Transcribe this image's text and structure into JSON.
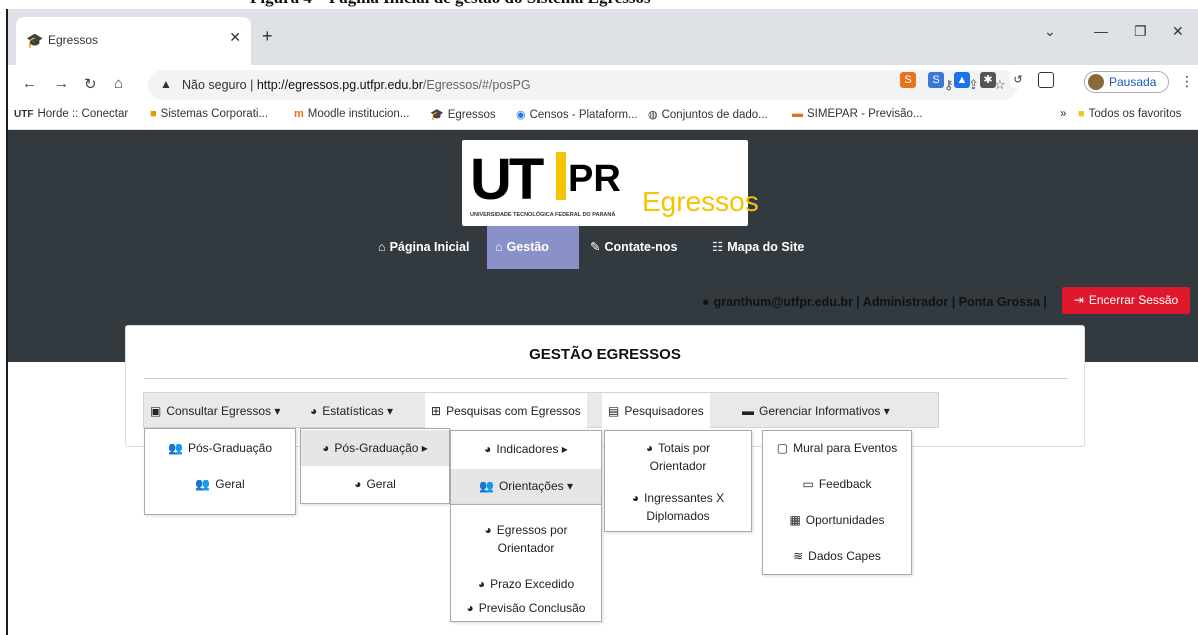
{
  "caption": "Figura 4 – Pagina Inicial de gestão do Sistema Egressos",
  "browser": {
    "tab_title": "Egressos",
    "address_warning": "Não seguro",
    "url_host": "http://egressos.pg.utfpr.edu.br",
    "url_path": "/Egressos/#/posPG",
    "profile_label": "Pausada"
  },
  "bookmarks": [
    {
      "label": "Horde :: Conectar",
      "icon": "utf-icon"
    },
    {
      "label": "Sistemas Corporati...",
      "icon": "sistemas-icon"
    },
    {
      "label": "Moodle institucion...",
      "icon": "moodle-icon"
    },
    {
      "label": "Egressos",
      "icon": "graduation-cap-icon"
    },
    {
      "label": "Censos - Plataform...",
      "icon": "censos-icon"
    },
    {
      "label": "Conjuntos de dado...",
      "icon": "globe-icon"
    },
    {
      "label": "SIMEPAR - Previsão...",
      "icon": "simepar-icon"
    },
    {
      "label": "Todos os favoritos",
      "icon": "folder-icon"
    }
  ],
  "logo": {
    "mark": "UT",
    "mark2": "PR",
    "sub": "UNIVERSIDADE TECNOLÓGICA FEDERAL DO PARANÁ",
    "product": "Egressos"
  },
  "nav": [
    {
      "label": "Página Inicial",
      "icon": "home-icon",
      "active": false
    },
    {
      "label": "Gestão",
      "icon": "institution-icon",
      "active": true
    },
    {
      "label": "Contate-nos",
      "icon": "edit-icon",
      "active": false
    },
    {
      "label": "Mapa do Site",
      "icon": "sitemap-icon",
      "active": false
    }
  ],
  "session": {
    "user": "granthum@utfpr.edu.br | Administrador | Ponta Grossa |",
    "logout": "Encerrar Sessão"
  },
  "panel": {
    "title": "GESTÃO EGRESSOS"
  },
  "menubar": [
    {
      "label": "Consultar Egressos",
      "icon": "id-card-icon"
    },
    {
      "label": "Estatísticas",
      "icon": "pie-chart-icon"
    },
    {
      "label": "Pesquisas com Egressos",
      "icon": "table-icon"
    },
    {
      "label": "Pesquisadores",
      "icon": "contact-book-icon"
    },
    {
      "label": "Gerenciar Informativos",
      "icon": "archive-icon"
    }
  ],
  "dropdowns": {
    "consultar": [
      "Pós-Graduação",
      "Geral"
    ],
    "estatisticas": [
      "Pós-Graduação",
      "Geral"
    ],
    "posgrad": [
      "Indicadores",
      "Orientações"
    ],
    "indicadores": [
      "Totais por Orientador",
      "Ingressantes X Diplomados"
    ],
    "orientacoes": [
      "Egressos por Orientador",
      "Prazo Excedido",
      "Previsão Conclusão"
    ],
    "informativos": [
      "Mural para Eventos",
      "Feedback",
      "Oportunidades",
      "Dados Capes"
    ]
  },
  "colors": {
    "header_bg": "#333a3f",
    "nav_active": "#8a90c8",
    "logout_red": "#e0182d",
    "logo_yellow": "#f5c400"
  }
}
